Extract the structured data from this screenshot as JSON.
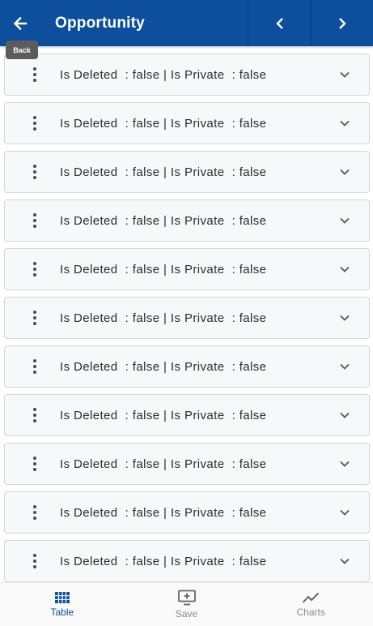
{
  "header": {
    "title": "Opportunity",
    "back_tooltip": "Back"
  },
  "rows": [
    {
      "text": "Is Deleted  : false | Is Private  : false"
    },
    {
      "text": "Is Deleted  : false | Is Private  : false"
    },
    {
      "text": "Is Deleted  : false | Is Private  : false"
    },
    {
      "text": "Is Deleted  : false | Is Private  : false"
    },
    {
      "text": "Is Deleted  : false | Is Private  : false"
    },
    {
      "text": "Is Deleted  : false | Is Private  : false"
    },
    {
      "text": "Is Deleted  : false | Is Private  : false"
    },
    {
      "text": "Is Deleted  : false | Is Private  : false"
    },
    {
      "text": "Is Deleted  : false | Is Private  : false"
    },
    {
      "text": "Is Deleted  : false | Is Private  : false"
    },
    {
      "text": "Is Deleted  : false | Is Private  : false"
    }
  ],
  "bottom_nav": [
    {
      "label": "Table",
      "icon": "table-grid-icon",
      "active": true
    },
    {
      "label": "Save",
      "icon": "save-monitor-icon",
      "active": false
    },
    {
      "label": "Charts",
      "icon": "line-chart-icon",
      "active": false
    }
  ],
  "colors": {
    "primary": "#0d4f9c",
    "row_bg": "#f7f8fa",
    "tooltip_bg": "#5c5c5c"
  }
}
